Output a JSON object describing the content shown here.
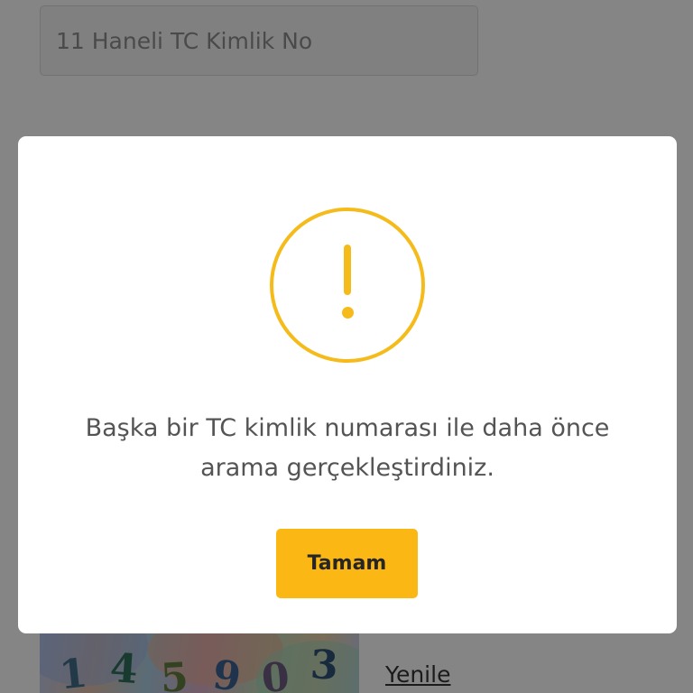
{
  "form": {
    "tc_input": {
      "value": "",
      "placeholder": "11 Haneli TC Kimlik No"
    },
    "captcha": {
      "digits": [
        "1",
        "4",
        "5",
        "9",
        "0",
        "3"
      ]
    },
    "refresh_label": "Yenile"
  },
  "alert": {
    "icon": "warning-exclamation-icon",
    "message": "Başka bir TC kimlik numarası ile daha önce arama gerçekleştirdiniz.",
    "ok_label": "Tamam"
  },
  "colors": {
    "accent": "#fbb713",
    "icon": "#f5bb1b",
    "overlay": "rgba(0,0,0,0.46)",
    "message_text": "#545454"
  }
}
